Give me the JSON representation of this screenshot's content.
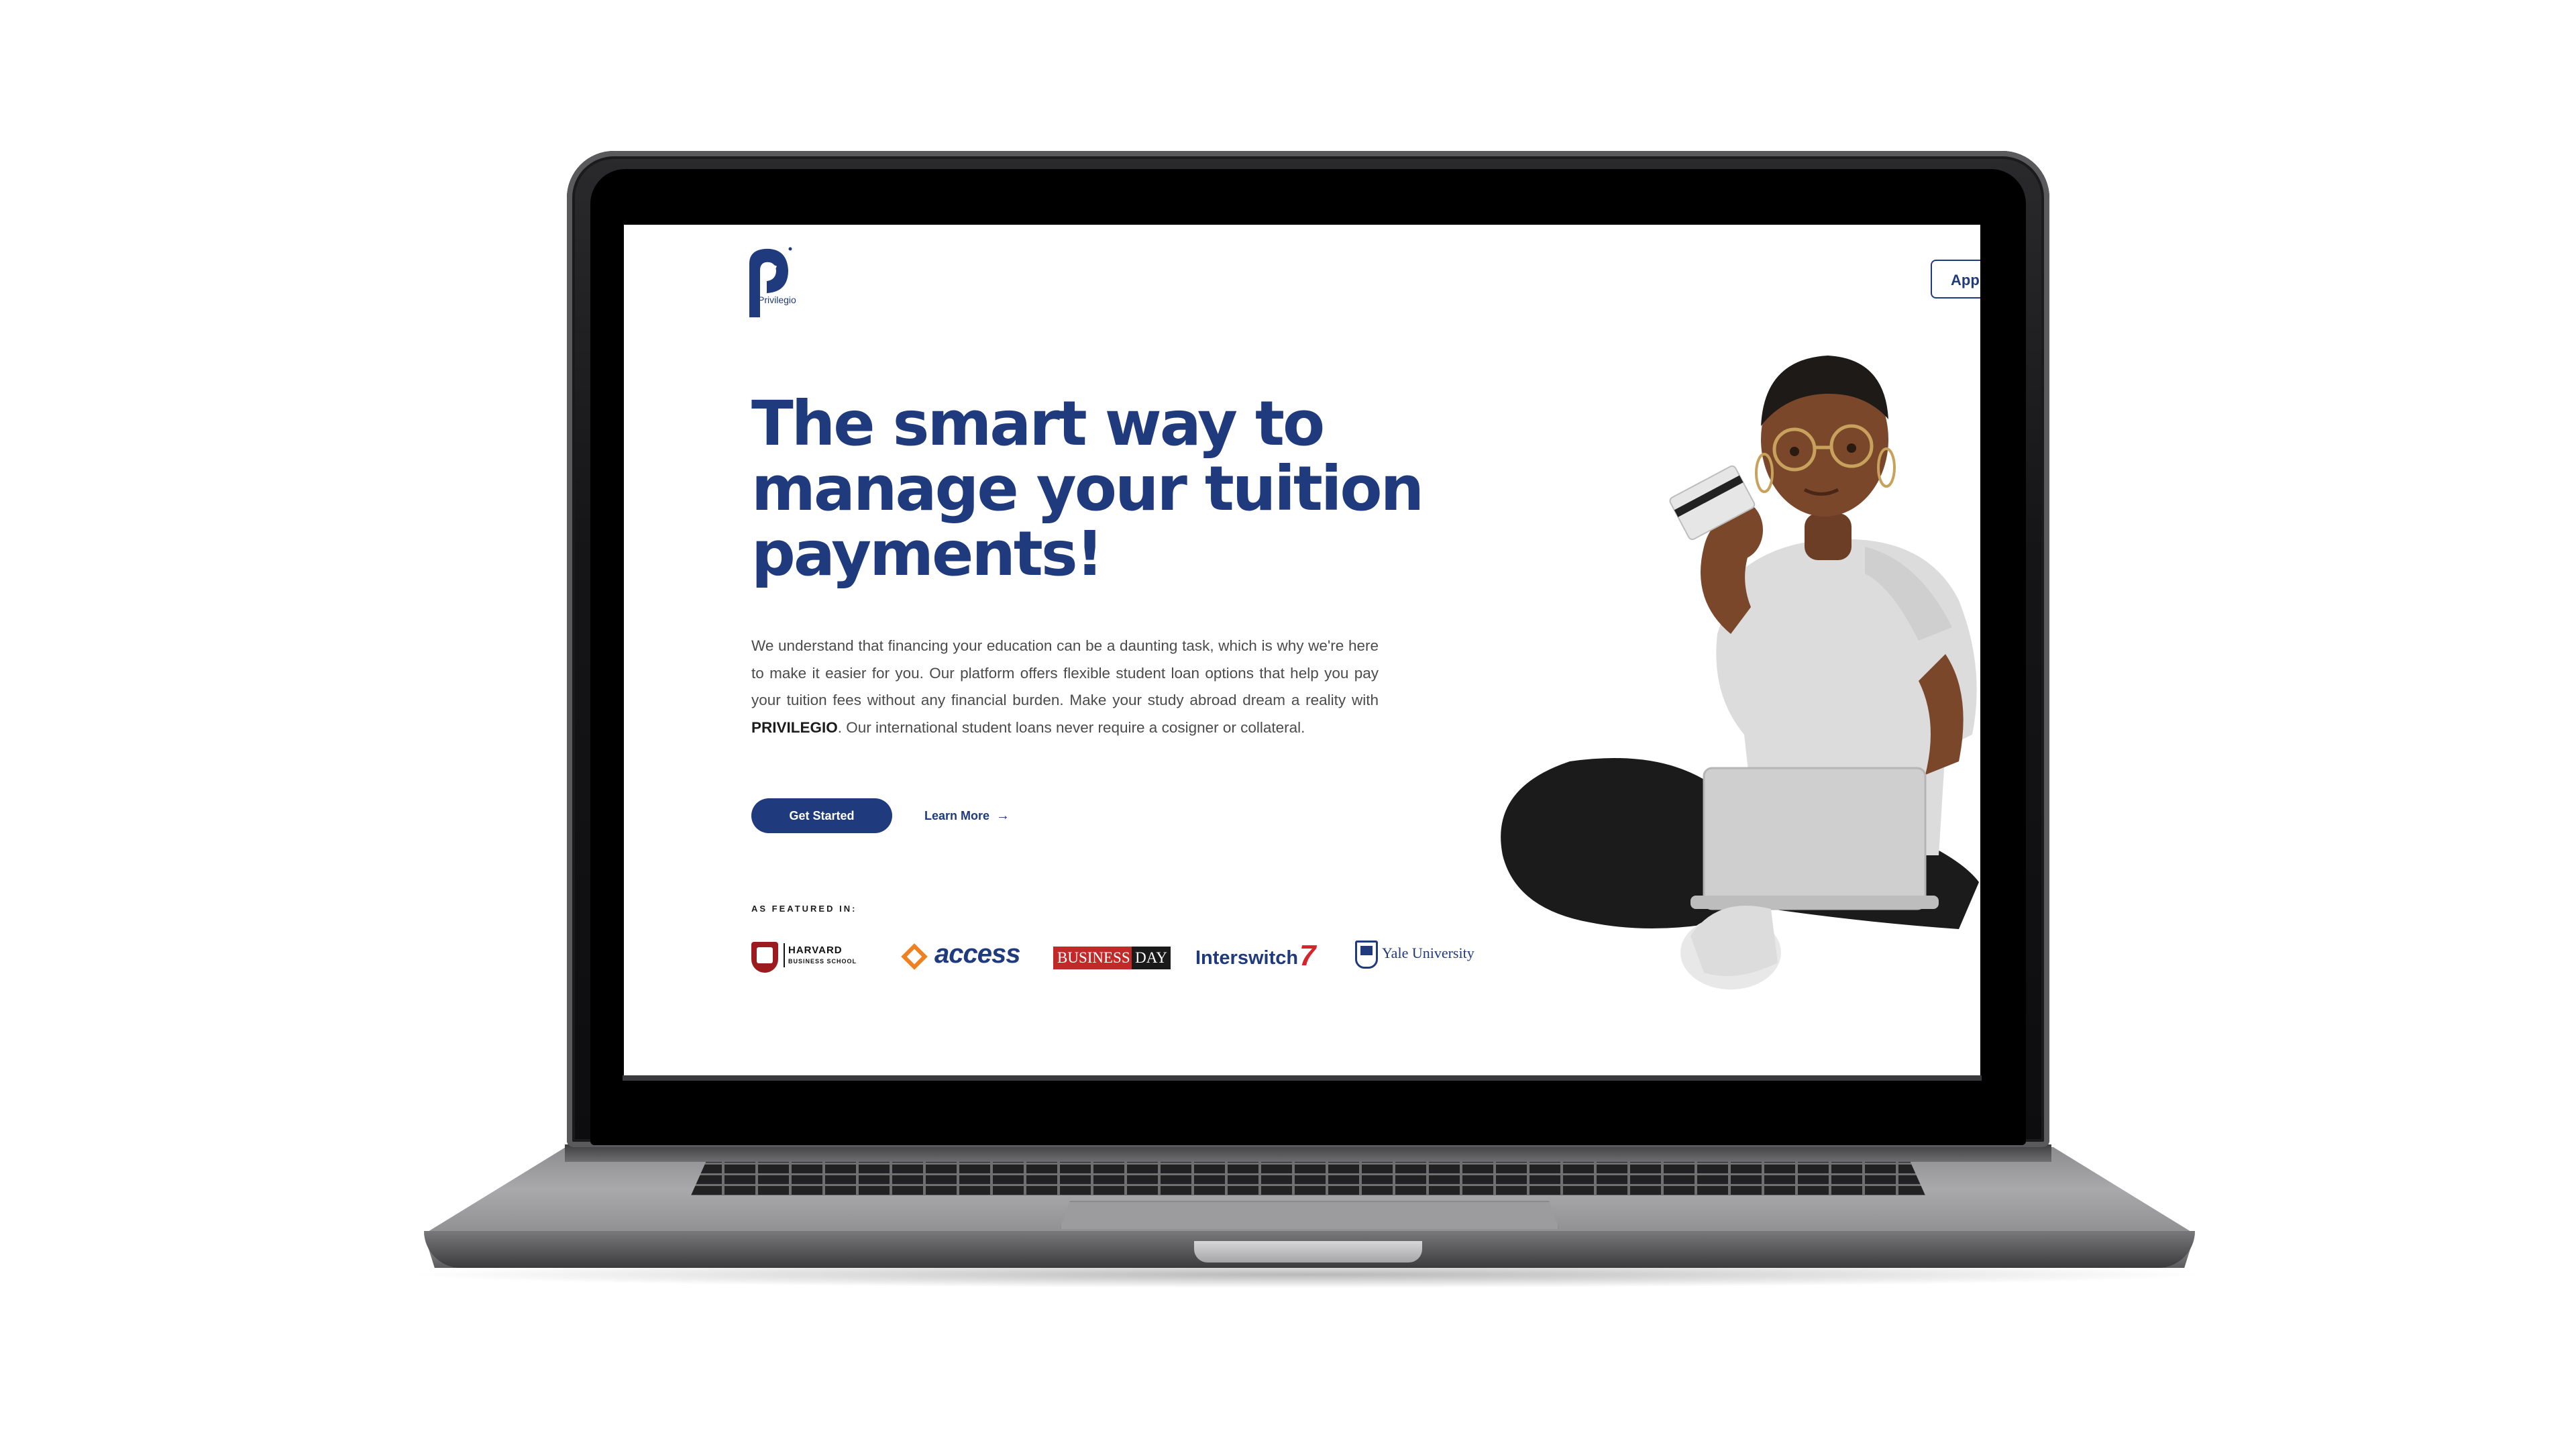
{
  "brand": {
    "name": "Privilegio",
    "color": "#1f3a7d"
  },
  "nav": {
    "apply_label": "Appl"
  },
  "hero": {
    "headline": "The smart way to manage your tuition payments!",
    "desc_before": "We understand that financing your education can be a daunting task, which is why we're here to make it easier for you. Our platform offers flexible student loan options that help you pay your tuition fees without any financial burden. Make your study abroad dream a reality with ",
    "desc_bold": "PRIVILEGIO",
    "desc_after": ". Our international student loans never require a cosigner or collateral.",
    "get_started": "Get Started",
    "learn_more": "Learn More",
    "learn_more_arrow": "→"
  },
  "featured": {
    "label": "AS FEATURED IN:",
    "partners": {
      "harvard_line1": "HARVARD",
      "harvard_line2": "BUSINESS SCHOOL",
      "access": "access",
      "businessday_1": "BUSINESS",
      "businessday_2": "DAY",
      "interswitch": "Interswitch",
      "yale": "Yale University"
    }
  }
}
